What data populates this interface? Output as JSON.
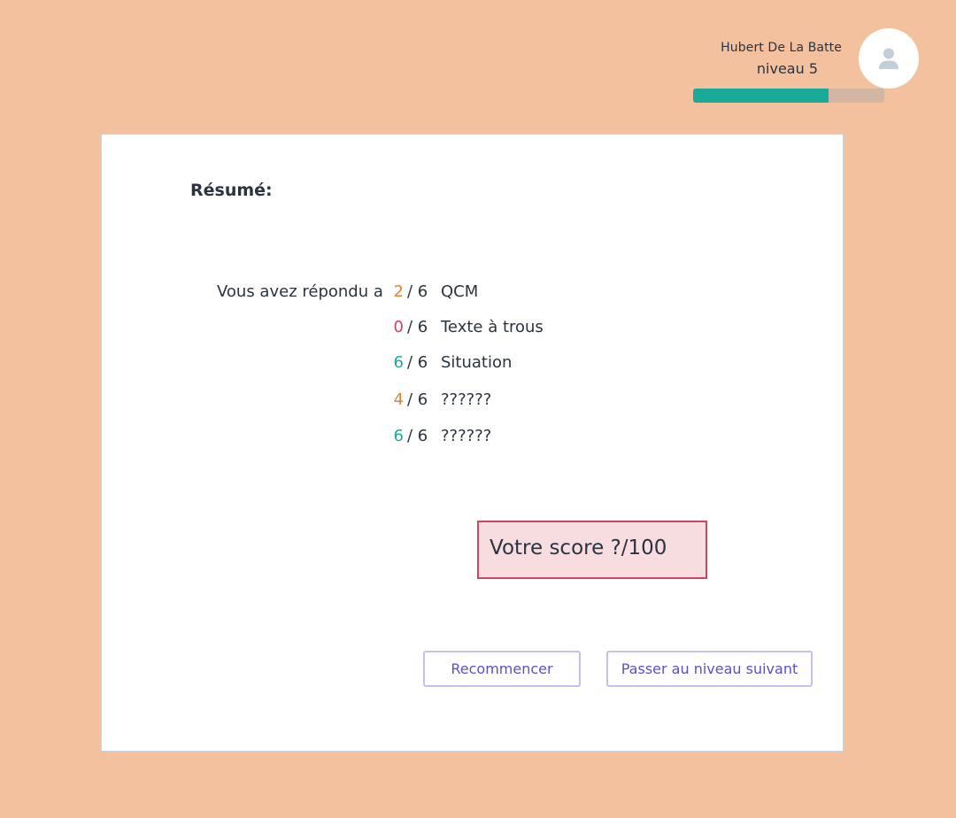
{
  "user": {
    "name": "Hubert De La Batte",
    "level": "niveau 5",
    "level_progress_fraction": 0.71
  },
  "colors": {
    "background": "#f3c19e",
    "progress_fill": "#1aaa9a",
    "progress_track": "#d2b6a3",
    "score_orange": "#e0833a",
    "score_red": "#c9485f",
    "score_teal": "#1aaa9a",
    "button_text": "#5b4fd0"
  },
  "summary": {
    "title": "Résumé:",
    "intro": "Vous avez répondu  a",
    "results": [
      {
        "score": "2",
        "total": "/ 6",
        "label": "QCM",
        "color": "#e0833a"
      },
      {
        "score": "0",
        "total": "/ 6",
        "label": "Texte à trous",
        "color": "#c9485f"
      },
      {
        "score": "6",
        "total": "/ 6",
        "label": "Situation",
        "color": "#1aaa9a"
      },
      {
        "score": "4",
        "total": "/ 6",
        "label": "??????",
        "color": "#e0833a"
      },
      {
        "score": "6",
        "total": "/ 6",
        "label": "??????",
        "color": "#1aaa9a"
      }
    ],
    "score_text": "Votre score ?/100"
  },
  "actions": {
    "restart_label": "Recommencer",
    "next_level_label": "Passer au niveau suivant"
  },
  "icons": {
    "avatar": "user-icon"
  }
}
